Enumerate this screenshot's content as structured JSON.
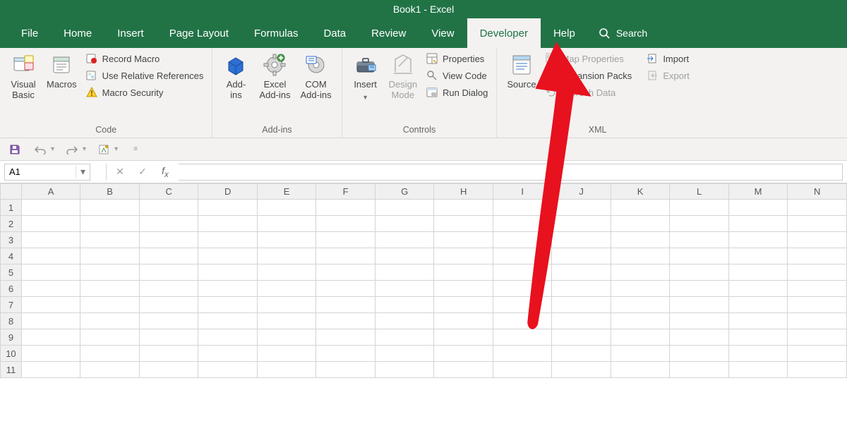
{
  "title": "Book1  -  Excel",
  "tabs": [
    "File",
    "Home",
    "Insert",
    "Page Layout",
    "Formulas",
    "Data",
    "Review",
    "View",
    "Developer",
    "Help"
  ],
  "active_tab": "Developer",
  "search_label": "Search",
  "ribbon": {
    "code": {
      "visual_basic": "Visual\nBasic",
      "macros": "Macros",
      "record_macro": "Record Macro",
      "use_relative": "Use Relative References",
      "macro_security": "Macro Security",
      "group_label": "Code"
    },
    "addins": {
      "addins": "Add-\nins",
      "excel_addins": "Excel\nAdd-ins",
      "com_addins": "COM\nAdd-ins",
      "group_label": "Add-ins"
    },
    "controls": {
      "insert": "Insert",
      "design_mode": "Design\nMode",
      "properties": "Properties",
      "view_code": "View Code",
      "run_dialog": "Run Dialog",
      "group_label": "Controls"
    },
    "xml": {
      "source": "Source",
      "map_props": "Map Properties",
      "expansion": "Expansion Packs",
      "refresh": "Refresh Data",
      "import": "Import",
      "export": "Export",
      "group_label": "XML"
    }
  },
  "namebox_value": "A1",
  "formula_value": "",
  "columns": [
    "A",
    "B",
    "C",
    "D",
    "E",
    "F",
    "G",
    "H",
    "I",
    "J",
    "K",
    "L",
    "M",
    "N"
  ],
  "rows": [
    1,
    2,
    3,
    4,
    5,
    6,
    7,
    8,
    9,
    10,
    11
  ]
}
